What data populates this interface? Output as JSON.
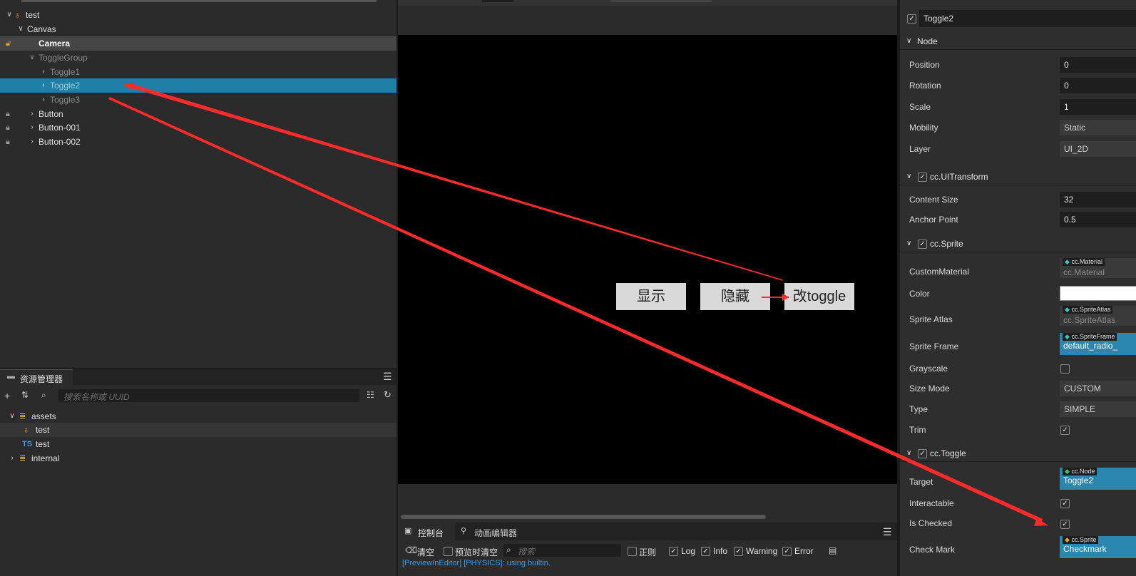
{
  "hierarchy": {
    "root": "test",
    "canvas": "Canvas",
    "camera": "Camera",
    "toggle_group": "ToggleGroup",
    "toggle1": "Toggle1",
    "toggle2": "Toggle2",
    "toggle3": "Toggle3",
    "button": "Button",
    "button001": "Button-001",
    "button002": "Button-002"
  },
  "assets": {
    "tab": "资源管理器",
    "search_placeholder": "搜索名称或 UUID",
    "root": "assets",
    "scene_item": "test",
    "ts_badge": "TS",
    "script_item": "test",
    "internal": "internal"
  },
  "scene": {
    "btn_show": "显示",
    "btn_hide": "隐藏",
    "btn_toggle": "改toggle"
  },
  "console": {
    "tab_console": "控制台",
    "tab_anim": "动画编辑器",
    "clear": "清空",
    "preview_clear": "预览时清空",
    "search_placeholder": "搜索",
    "regex": "正则",
    "log": "Log",
    "info": "Info",
    "warning": "Warning",
    "error": "Error",
    "log_line": "[PreviewInEditor] [PHYSICS]: using builtin."
  },
  "inspector": {
    "node_name": "Toggle2",
    "node_section": "Node",
    "position_label": "Position",
    "position_val": "0",
    "rotation_label": "Rotation",
    "rotation_val": "0",
    "scale_label": "Scale",
    "scale_val": "1",
    "mobility_label": "Mobility",
    "mobility_val": "Static",
    "layer_label": "Layer",
    "layer_val": "UI_2D",
    "uitransform_section": "cc.UITransform",
    "content_size_label": "Content Size",
    "content_size_val": "32",
    "anchor_label": "Anchor Point",
    "anchor_val": "0.5",
    "sprite_section": "cc.Sprite",
    "custom_material_label": "CustomMaterial",
    "custom_material_tag": "cc.Material",
    "custom_material_val": "cc.Material",
    "color_label": "Color",
    "sprite_atlas_label": "Sprite Atlas",
    "sprite_atlas_tag": "cc.SpriteAtlas",
    "sprite_atlas_val": "cc.SpriteAtlas",
    "sprite_frame_label": "Sprite Frame",
    "sprite_frame_tag": "cc.SpriteFrame",
    "sprite_frame_val": "default_radio_",
    "grayscale_label": "Grayscale",
    "size_mode_label": "Size Mode",
    "size_mode_val": "CUSTOM",
    "type_label": "Type",
    "type_val": "SIMPLE",
    "trim_label": "Trim",
    "toggle_section": "cc.Toggle",
    "target_label": "Target",
    "target_tag": "cc.Node",
    "target_val": "Toggle2",
    "interactable_label": "Interactable",
    "is_checked_label": "Is Checked",
    "check_mark_label": "Check Mark",
    "check_mark_tag": "cc.Sprite",
    "check_mark_val": "Checkmark"
  },
  "colors": {
    "selection": "#1f7fa6",
    "arrow": "#ff2a2a"
  }
}
